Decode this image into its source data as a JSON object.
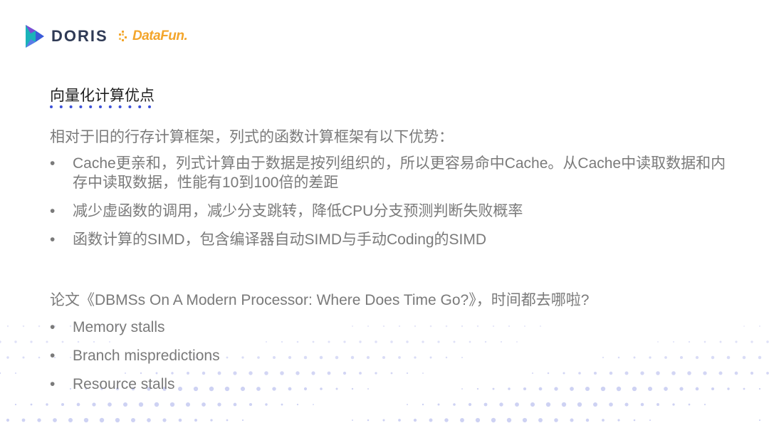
{
  "brand": {
    "doris": "DORIS",
    "datafun": "DataFun."
  },
  "colors": {
    "doris_teal": "#1ab3b9",
    "doris_blue": "#3a5bd9",
    "doris_purple": "#7e4bd6",
    "datafun_orange": "#f3a52b",
    "title_dots": "#3b50d8",
    "dot_pattern": "#c9cdf2"
  },
  "slide": {
    "title": "向量化计算优点",
    "intro": "相对于旧的行存计算框架，列式的函数计算框架有以下优势：",
    "advantages": [
      "Cache更亲和，列式计算由于数据是按列组织的，所以更容易命中Cache。从Cache中读取数据和内存中读取数据，性能有10到100倍的差距",
      "减少虚函数的调用，减少分支跳转，降低CPU分支预测判断失败概率",
      "函数计算的SIMD，包含编译器自动SIMD与手动Coding的SIMD"
    ],
    "paper_question": "论文《DBMSs On A Modern Processor: Where Does Time Go?》，时间都去哪啦?",
    "time_sinks": [
      "Memory stalls",
      "Branch mispredictions",
      "Resource stalls"
    ],
    "bullet_char": "•"
  }
}
